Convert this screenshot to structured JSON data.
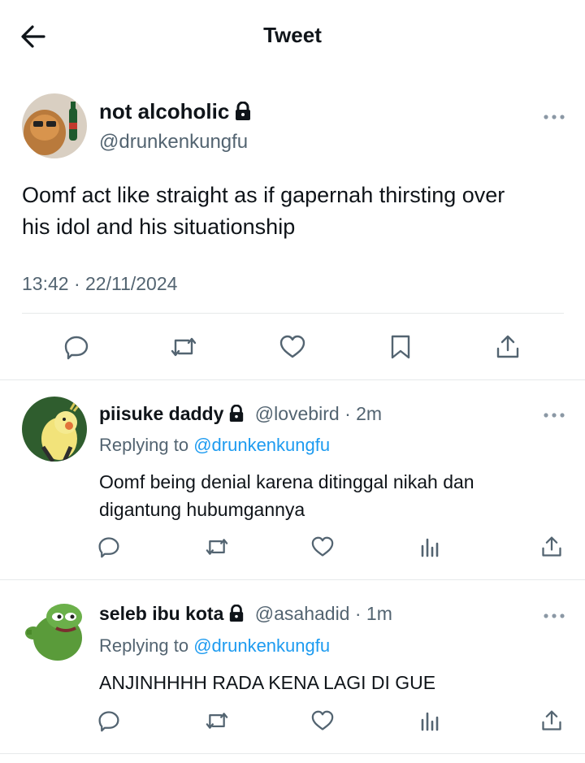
{
  "header": {
    "title": "Tweet"
  },
  "main_tweet": {
    "name": "not alcoholic",
    "handle": "@drunkenkungfu",
    "text_line1": "Oomf act like straight as if gapernah thirsting over",
    "text_line2": "his idol and his situationship",
    "time": "13:42",
    "separator": "·",
    "date": "22/11/2024"
  },
  "replies": [
    {
      "name": "piisuke daddy",
      "handle": "@lovebird",
      "age": "· 2m",
      "replying_prefix": "Replying to",
      "replying_to": "@drunkenkungfu",
      "text_line1": "Oomf being denial karena ditinggal nikah dan",
      "text_line2": "digantung hubumgannya"
    },
    {
      "name": "seleb ibu kota",
      "handle": "@asahadid",
      "age": "· 1m",
      "replying_prefix": "Replying to",
      "replying_to": "@drunkenkungfu",
      "text_line1": "ANJINHHHH RADA KENA LAGI DI GUE"
    }
  ],
  "colors": {
    "link": "#1d9bf0",
    "muted": "#536471",
    "text": "#0f1419",
    "divider": "#e6e9ea"
  }
}
